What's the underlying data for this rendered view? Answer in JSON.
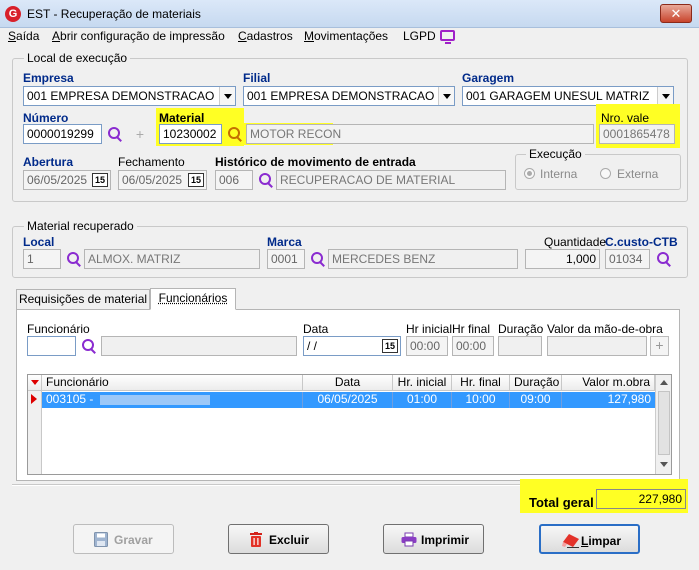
{
  "window": {
    "title": "EST - Recuperação de materiais",
    "close": "✕"
  },
  "menu": {
    "items": [
      {
        "label": "Saída",
        "underline": "S"
      },
      {
        "label": "Abrir configuração de impressão",
        "underline": "A"
      },
      {
        "label": "Cadastros",
        "underline": "C"
      },
      {
        "label": "Movimentações",
        "underline": "M"
      },
      {
        "label": "LGPD",
        "underline": ""
      }
    ]
  },
  "local_execucao": {
    "legend": "Local de execução",
    "empresa": {
      "label": "Empresa",
      "value": "001 EMPRESA DEMONSTRACAO"
    },
    "filial": {
      "label": "Filial",
      "value": "001 EMPRESA DEMONSTRACAO"
    },
    "garagem": {
      "label": "Garagem",
      "value": "001 GARAGEM UNESUL MATRIZ"
    },
    "numero": {
      "label": "Número",
      "value": "0000019299"
    },
    "material": {
      "label": "Material",
      "code": "10230002",
      "description": "MOTOR RECON"
    },
    "nro_vale": {
      "label": "Nro. vale",
      "value": "0001865478"
    },
    "abertura": {
      "label": "Abertura",
      "value": "06/05/2025"
    },
    "fechamento": {
      "label": "Fechamento",
      "value": "06/05/2025"
    },
    "historico": {
      "label": "Histórico de movimento de entrada",
      "code": "006",
      "description": "RECUPERACAO DE MATERIAL"
    },
    "execucao": {
      "legend": "Execução",
      "options": [
        "Interna",
        "Externa"
      ],
      "selected": "Interna"
    },
    "calendar_icon_text": "15"
  },
  "material_recuperado": {
    "legend": "Material recuperado",
    "local": {
      "label": "Local",
      "code": "1",
      "description": "ALMOX. MATRIZ"
    },
    "marca": {
      "label": "Marca",
      "code": "0001",
      "description": "MERCEDES BENZ"
    },
    "quantidade": {
      "label": "Quantidade",
      "value": "1,000"
    },
    "ccusto": {
      "label": "C.custo-CTB",
      "value": "01034"
    }
  },
  "tabs": [
    {
      "label": "Requisições de material",
      "active": false
    },
    {
      "label": "Funcionários",
      "active": true
    }
  ],
  "funcionarios_form": {
    "funcionario_label": "Funcionário",
    "data_label": "Data",
    "data_value": " /  /",
    "hr_inicial_label": "Hr inicial",
    "hr_inicial_value": "00:00",
    "hr_final_label": "Hr final",
    "hr_final_value": "00:00",
    "duracao_label": "Duração",
    "valor_label": "Valor da mão-de-obra",
    "add": "+"
  },
  "grid": {
    "columns": [
      "Funcionário",
      "Data",
      "Hr. inicial",
      "Hr. final",
      "Duração",
      "Valor m.obra"
    ],
    "rows": [
      {
        "funcionario": "003105 -",
        "data": "06/05/2025",
        "hr_inicial": "01:00",
        "hr_final": "10:00",
        "duracao": "09:00",
        "valor": "127,980"
      }
    ]
  },
  "total": {
    "label": "Total geral",
    "value": "227,980"
  },
  "buttons": {
    "gravar": "Gravar",
    "excluir": "Excluir",
    "imprimir": "Imprimir",
    "limpar": "Limpar"
  },
  "colors": {
    "highlight": "#ffff24",
    "selection": "#3399ff",
    "accent_purple": "#8a2bd0"
  }
}
